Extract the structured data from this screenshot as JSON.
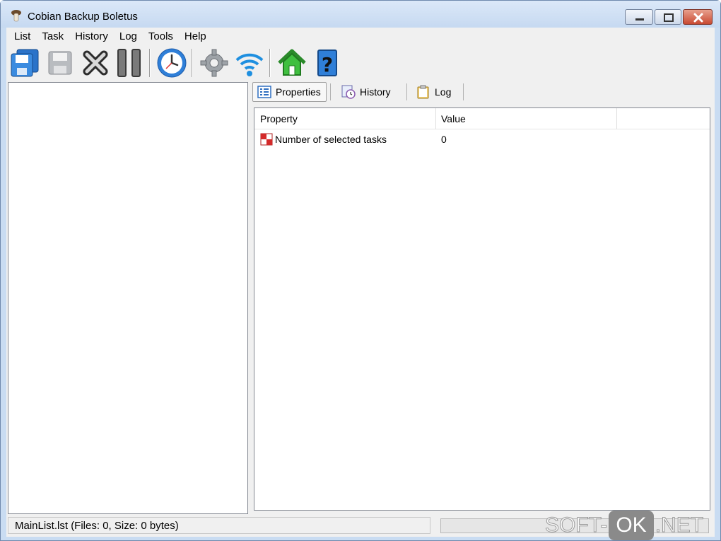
{
  "window": {
    "title": "Cobian Backup Boletus"
  },
  "menu": [
    "List",
    "Task",
    "History",
    "Log",
    "Tools",
    "Help"
  ],
  "toolbar": {
    "buttons": [
      "save-all-icon",
      "save-icon",
      "delete-icon",
      "pause-icon",
      "clock-icon",
      "settings-icon",
      "wireless-icon",
      "home-icon",
      "help-icon"
    ]
  },
  "tabs": [
    {
      "label": "Properties",
      "icon": "properties-icon",
      "active": true
    },
    {
      "label": "History",
      "icon": "history-icon",
      "active": false
    },
    {
      "label": "Log",
      "icon": "log-icon",
      "active": false
    }
  ],
  "properties": {
    "columns": [
      "Property",
      "Value"
    ],
    "rows": [
      {
        "property": "Number of selected tasks",
        "value": "0",
        "icon": "tasks-icon"
      }
    ]
  },
  "status": {
    "text": "MainList.lst  (Files: 0, Size: 0 bytes)",
    "progress": 0
  },
  "watermark": {
    "left": "SOFT-",
    "mid": "OK",
    "right": ".NET"
  }
}
